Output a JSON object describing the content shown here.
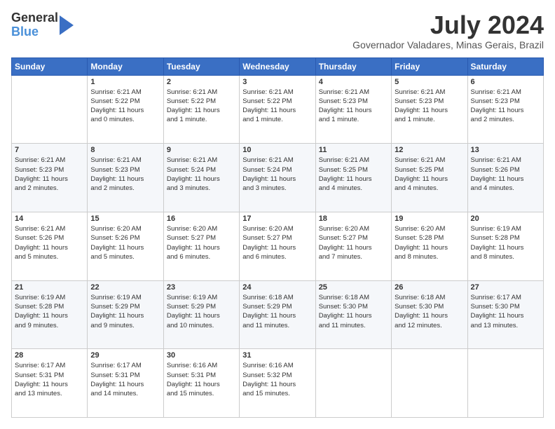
{
  "logo": {
    "general": "General",
    "blue": "Blue"
  },
  "header": {
    "month_year": "July 2024",
    "location": "Governador Valadares, Minas Gerais, Brazil"
  },
  "days_of_week": [
    "Sunday",
    "Monday",
    "Tuesday",
    "Wednesday",
    "Thursday",
    "Friday",
    "Saturday"
  ],
  "weeks": [
    [
      {
        "day": "",
        "info": ""
      },
      {
        "day": "1",
        "info": "Sunrise: 6:21 AM\nSunset: 5:22 PM\nDaylight: 11 hours\nand 0 minutes."
      },
      {
        "day": "2",
        "info": "Sunrise: 6:21 AM\nSunset: 5:22 PM\nDaylight: 11 hours\nand 1 minute."
      },
      {
        "day": "3",
        "info": "Sunrise: 6:21 AM\nSunset: 5:22 PM\nDaylight: 11 hours\nand 1 minute."
      },
      {
        "day": "4",
        "info": "Sunrise: 6:21 AM\nSunset: 5:23 PM\nDaylight: 11 hours\nand 1 minute."
      },
      {
        "day": "5",
        "info": "Sunrise: 6:21 AM\nSunset: 5:23 PM\nDaylight: 11 hours\nand 1 minute."
      },
      {
        "day": "6",
        "info": "Sunrise: 6:21 AM\nSunset: 5:23 PM\nDaylight: 11 hours\nand 2 minutes."
      }
    ],
    [
      {
        "day": "7",
        "info": "Sunrise: 6:21 AM\nSunset: 5:23 PM\nDaylight: 11 hours\nand 2 minutes."
      },
      {
        "day": "8",
        "info": "Sunrise: 6:21 AM\nSunset: 5:23 PM\nDaylight: 11 hours\nand 2 minutes."
      },
      {
        "day": "9",
        "info": "Sunrise: 6:21 AM\nSunset: 5:24 PM\nDaylight: 11 hours\nand 3 minutes."
      },
      {
        "day": "10",
        "info": "Sunrise: 6:21 AM\nSunset: 5:24 PM\nDaylight: 11 hours\nand 3 minutes."
      },
      {
        "day": "11",
        "info": "Sunrise: 6:21 AM\nSunset: 5:25 PM\nDaylight: 11 hours\nand 4 minutes."
      },
      {
        "day": "12",
        "info": "Sunrise: 6:21 AM\nSunset: 5:25 PM\nDaylight: 11 hours\nand 4 minutes."
      },
      {
        "day": "13",
        "info": "Sunrise: 6:21 AM\nSunset: 5:26 PM\nDaylight: 11 hours\nand 4 minutes."
      }
    ],
    [
      {
        "day": "14",
        "info": "Sunrise: 6:21 AM\nSunset: 5:26 PM\nDaylight: 11 hours\nand 5 minutes."
      },
      {
        "day": "15",
        "info": "Sunrise: 6:20 AM\nSunset: 5:26 PM\nDaylight: 11 hours\nand 5 minutes."
      },
      {
        "day": "16",
        "info": "Sunrise: 6:20 AM\nSunset: 5:27 PM\nDaylight: 11 hours\nand 6 minutes."
      },
      {
        "day": "17",
        "info": "Sunrise: 6:20 AM\nSunset: 5:27 PM\nDaylight: 11 hours\nand 6 minutes."
      },
      {
        "day": "18",
        "info": "Sunrise: 6:20 AM\nSunset: 5:27 PM\nDaylight: 11 hours\nand 7 minutes."
      },
      {
        "day": "19",
        "info": "Sunrise: 6:20 AM\nSunset: 5:28 PM\nDaylight: 11 hours\nand 8 minutes."
      },
      {
        "day": "20",
        "info": "Sunrise: 6:19 AM\nSunset: 5:28 PM\nDaylight: 11 hours\nand 8 minutes."
      }
    ],
    [
      {
        "day": "21",
        "info": "Sunrise: 6:19 AM\nSunset: 5:28 PM\nDaylight: 11 hours\nand 9 minutes."
      },
      {
        "day": "22",
        "info": "Sunrise: 6:19 AM\nSunset: 5:29 PM\nDaylight: 11 hours\nand 9 minutes."
      },
      {
        "day": "23",
        "info": "Sunrise: 6:19 AM\nSunset: 5:29 PM\nDaylight: 11 hours\nand 10 minutes."
      },
      {
        "day": "24",
        "info": "Sunrise: 6:18 AM\nSunset: 5:29 PM\nDaylight: 11 hours\nand 11 minutes."
      },
      {
        "day": "25",
        "info": "Sunrise: 6:18 AM\nSunset: 5:30 PM\nDaylight: 11 hours\nand 11 minutes."
      },
      {
        "day": "26",
        "info": "Sunrise: 6:18 AM\nSunset: 5:30 PM\nDaylight: 11 hours\nand 12 minutes."
      },
      {
        "day": "27",
        "info": "Sunrise: 6:17 AM\nSunset: 5:30 PM\nDaylight: 11 hours\nand 13 minutes."
      }
    ],
    [
      {
        "day": "28",
        "info": "Sunrise: 6:17 AM\nSunset: 5:31 PM\nDaylight: 11 hours\nand 13 minutes."
      },
      {
        "day": "29",
        "info": "Sunrise: 6:17 AM\nSunset: 5:31 PM\nDaylight: 11 hours\nand 14 minutes."
      },
      {
        "day": "30",
        "info": "Sunrise: 6:16 AM\nSunset: 5:31 PM\nDaylight: 11 hours\nand 15 minutes."
      },
      {
        "day": "31",
        "info": "Sunrise: 6:16 AM\nSunset: 5:32 PM\nDaylight: 11 hours\nand 15 minutes."
      },
      {
        "day": "",
        "info": ""
      },
      {
        "day": "",
        "info": ""
      },
      {
        "day": "",
        "info": ""
      }
    ]
  ]
}
